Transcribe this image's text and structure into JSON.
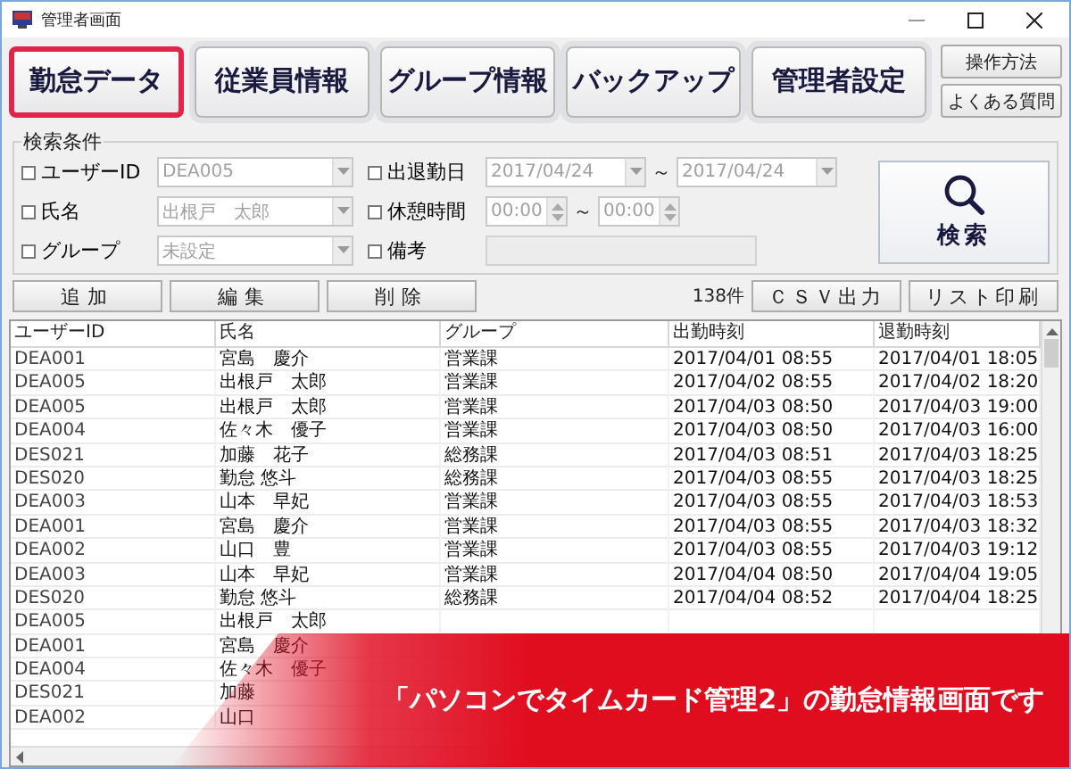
{
  "window": {
    "title": "管理者画面"
  },
  "nav": [
    {
      "label": "勤怠データ",
      "selected": true
    },
    {
      "label": "従業員情報",
      "selected": false
    },
    {
      "label": "グループ情報",
      "selected": false
    },
    {
      "label": "バックアップ",
      "selected": false
    },
    {
      "label": "管理者設定",
      "selected": false
    }
  ],
  "help_buttons": [
    "操作方法",
    "よくある質問"
  ],
  "search": {
    "legend": "検索条件",
    "left": [
      {
        "label": "ユーザーID",
        "checked": false,
        "value": "DEA005",
        "disabled": true
      },
      {
        "label": "氏名",
        "checked": false,
        "value": "出根戸　太郎",
        "disabled": true
      },
      {
        "label": "グループ",
        "checked": false,
        "value": "未設定",
        "disabled": true
      }
    ],
    "right": [
      {
        "kind": "daterange",
        "label": "出退勤日",
        "checked": false,
        "from": "2017/04/24",
        "sep": "～",
        "to": "2017/04/24",
        "disabled": true
      },
      {
        "kind": "timerange",
        "label": "休憩時間",
        "checked": false,
        "from": "00:00",
        "sep": "～",
        "to": "00:00",
        "disabled": true
      },
      {
        "kind": "text",
        "label": "備考",
        "checked": false,
        "disabled": true
      }
    ],
    "button": "検索"
  },
  "actions": [
    "追加",
    "編集",
    "削除"
  ],
  "count": "138件",
  "export_buttons": [
    "ＣＳＶ出力",
    "リスト印刷"
  ],
  "table": {
    "columns": [
      "ユーザーID",
      "氏名",
      "グループ",
      "出勤時刻",
      "退勤時刻"
    ],
    "rows": [
      [
        "DEA001",
        "宮島　慶介",
        "営業課",
        "2017/04/01 08:55",
        "2017/04/01 18:05"
      ],
      [
        "DEA005",
        "出根戸　太郎",
        "営業課",
        "2017/04/02 08:55",
        "2017/04/02 18:20"
      ],
      [
        "DEA005",
        "出根戸　太郎",
        "営業課",
        "2017/04/03 08:50",
        "2017/04/03 19:00"
      ],
      [
        "DEA004",
        "佐々木　優子",
        "営業課",
        "2017/04/03 08:50",
        "2017/04/03 16:00"
      ],
      [
        "DES021",
        "加藤　花子",
        "総務課",
        "2017/04/03 08:51",
        "2017/04/03 18:25"
      ],
      [
        "DES020",
        "勤怠 悠斗",
        "総務課",
        "2017/04/03 08:55",
        "2017/04/03 18:25"
      ],
      [
        "DEA003",
        "山本　早妃",
        "営業課",
        "2017/04/03 08:55",
        "2017/04/03 18:53"
      ],
      [
        "DEA001",
        "宮島　慶介",
        "営業課",
        "2017/04/03 08:55",
        "2017/04/03 18:32"
      ],
      [
        "DEA002",
        "山口　豊",
        "営業課",
        "2017/04/03 08:55",
        "2017/04/03 19:12"
      ],
      [
        "DEA003",
        "山本　早妃",
        "営業課",
        "2017/04/04 08:50",
        "2017/04/04 19:05"
      ],
      [
        "DES020",
        "勤怠 悠斗",
        "総務課",
        "2017/04/04 08:52",
        "2017/04/04 18:25"
      ],
      [
        "DEA005",
        "出根戸　太郎"
      ],
      [
        "DEA001",
        "宮島　慶介"
      ],
      [
        "DEA004",
        "佐々木　優子"
      ],
      [
        "DES021",
        "加藤"
      ],
      [
        "DEA002",
        "山口"
      ]
    ]
  },
  "banner": "「パソコンでタイムカード管理2」の勤怠情報画面です"
}
